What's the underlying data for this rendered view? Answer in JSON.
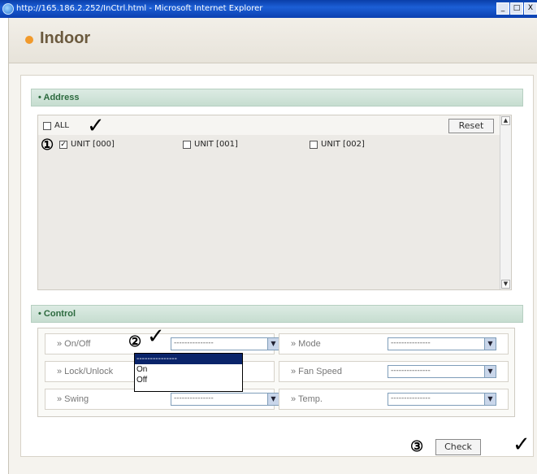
{
  "window": {
    "title": "http://165.186.2.252/InCtrl.html - Microsoft Internet Explorer",
    "controls": [
      "_",
      "□",
      "X"
    ]
  },
  "header": {
    "title": "Indoor",
    "accent_color": "#f19a2c"
  },
  "address": {
    "section_title": "• Address",
    "all_label": "ALL",
    "all_checked": false,
    "reset_label": "Reset",
    "units": [
      {
        "label": "UNIT [000]",
        "checked": true
      },
      {
        "label": "UNIT [001]",
        "checked": false
      },
      {
        "label": "UNIT [002]",
        "checked": false
      }
    ]
  },
  "control": {
    "section_title": "• Control",
    "rows": [
      {
        "left_label": "» On/Off",
        "left_value": "---------------",
        "right_label": "» Mode",
        "right_value": "---------------"
      },
      {
        "left_label": "» Lock/Unlock",
        "left_value": "",
        "right_label": "» Fan Speed",
        "right_value": "---------------"
      },
      {
        "left_label": "» Swing",
        "left_value": "---------------",
        "right_label": "» Temp.",
        "right_value": "---------------"
      }
    ],
    "dropdown_options": [
      "---------------",
      "On",
      "Off"
    ],
    "dropdown_selected_index": 0
  },
  "footer": {
    "check_label": "Check"
  },
  "annotations": {
    "step1": "①",
    "step2": "②",
    "step3": "③",
    "tick": "✓"
  }
}
